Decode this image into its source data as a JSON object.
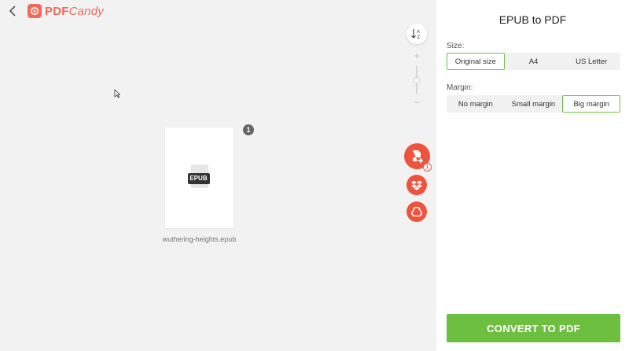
{
  "header": {
    "logo_text_bold": "PDF",
    "logo_text_rest": "Candy"
  },
  "workspace": {
    "file": {
      "name": "wuthering-heights.epub",
      "format_label": "EPUB",
      "count_badge": "1"
    },
    "zoom": {
      "plus": "+",
      "minus": "−",
      "level_fraction": 0.5
    },
    "add_badge": "1",
    "icons": [
      "back-arrow-icon",
      "sort-az-icon",
      "add-file-icon",
      "dropbox-icon",
      "google-drive-icon"
    ]
  },
  "panel": {
    "title": "EPUB to PDF",
    "size_label": "Size:",
    "size_options": [
      "Original size",
      "A4",
      "US Letter"
    ],
    "size_selected": "Original size",
    "margin_label": "Margin:",
    "margin_options": [
      "No margin",
      "Small margin",
      "Big margin"
    ],
    "margin_selected": "Big margin",
    "convert_label": "CONVERT TO PDF"
  },
  "colors": {
    "brand": "#f06a5b",
    "fab": "#f0533d",
    "accent_green": "#6cbf3f"
  }
}
